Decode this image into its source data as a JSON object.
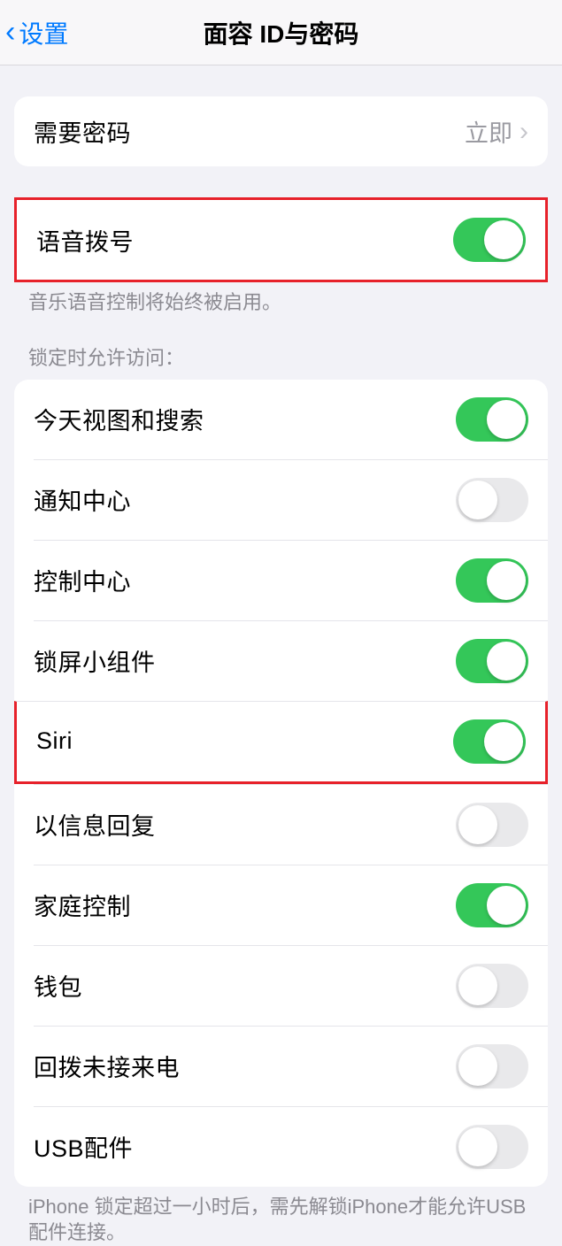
{
  "navbar": {
    "back_label": "设置",
    "title": "面容 ID与密码"
  },
  "require_passcode": {
    "label": "需要密码",
    "value": "立即"
  },
  "voice_dial": {
    "label": "语音拨号",
    "enabled": true,
    "footer": "音乐语音控制将始终被启用。"
  },
  "allow_access_header": "锁定时允许访问：",
  "allow_access": {
    "items": [
      {
        "label": "今天视图和搜索",
        "enabled": true
      },
      {
        "label": "通知中心",
        "enabled": false
      },
      {
        "label": "控制中心",
        "enabled": true
      },
      {
        "label": "锁屏小组件",
        "enabled": true
      },
      {
        "label": "Siri",
        "enabled": true,
        "highlight": true
      },
      {
        "label": "以信息回复",
        "enabled": false
      },
      {
        "label": "家庭控制",
        "enabled": true
      },
      {
        "label": "钱包",
        "enabled": false
      },
      {
        "label": "回拨未接来电",
        "enabled": false
      },
      {
        "label": "USB配件",
        "enabled": false
      }
    ],
    "footer": "iPhone 锁定超过一小时后，需先解锁iPhone才能允许USB 配件连接。"
  }
}
